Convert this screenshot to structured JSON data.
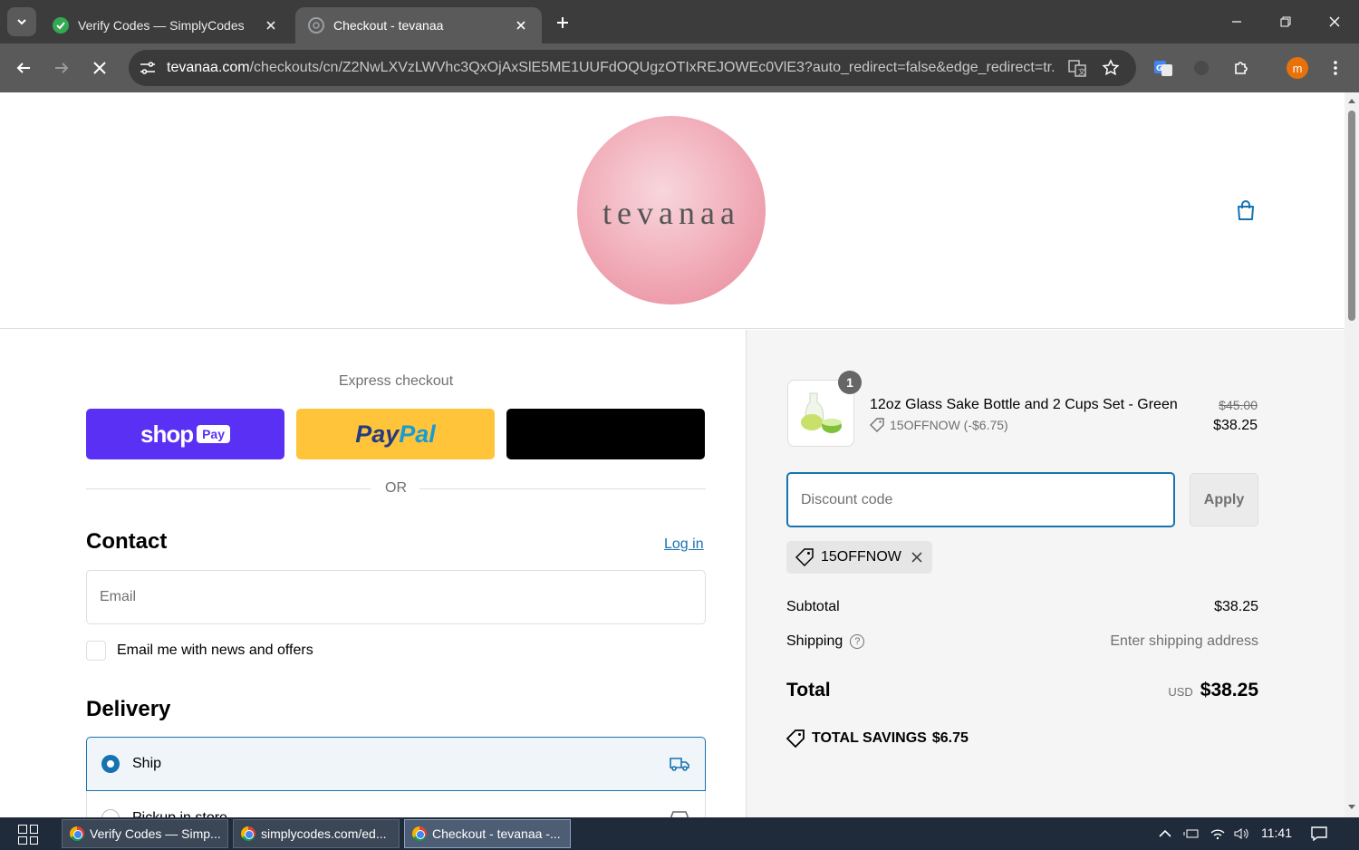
{
  "browser": {
    "tabs": [
      {
        "title": "Verify Codes — SimplyCodes",
        "active": false
      },
      {
        "title": "Checkout - tevanaa",
        "active": true
      }
    ],
    "url_host": "tevanaa.com",
    "url_path": "/checkouts/cn/Z2NwLXVzLWVhc3QxOjAxSlE5ME1UUFdOQUgzOTIxREJOWEc0VlE3?auto_redirect=false&edge_redirect=tr...",
    "profile_initial": "m"
  },
  "store": {
    "logo_text": "tevanaa"
  },
  "checkout": {
    "express_label": "Express checkout",
    "shop_pay": {
      "word": "shop",
      "badge": "Pay"
    },
    "paypal": {
      "part1": "Pay",
      "part2": "Pal"
    },
    "or_text": "OR",
    "contact_title": "Contact",
    "login_label": "Log in",
    "email_placeholder": "Email",
    "newsletter_label": "Email me with news and offers",
    "delivery_title": "Delivery",
    "delivery_options": [
      {
        "label": "Ship",
        "selected": true
      },
      {
        "label": "Pickup in store",
        "selected": false
      }
    ]
  },
  "summary": {
    "item": {
      "quantity": "1",
      "name": "12oz Glass Sake Bottle and 2 Cups Set - Green",
      "discount": "15OFFNOW (-$6.75)",
      "original_price": "$45.00",
      "price": "$38.25"
    },
    "discount_placeholder": "Discount code",
    "apply_label": "Apply",
    "applied_code": "15OFFNOW",
    "subtotal_label": "Subtotal",
    "subtotal_value": "$38.25",
    "shipping_label": "Shipping",
    "shipping_value": "Enter shipping address",
    "total_label": "Total",
    "currency": "USD",
    "total_value": "$38.25",
    "savings_label": "TOTAL SAVINGS",
    "savings_value": "$6.75"
  },
  "taskbar": {
    "items": [
      {
        "title": "Verify Codes — Simp...",
        "active": false
      },
      {
        "title": "simplycodes.com/ed...",
        "active": false
      },
      {
        "title": "Checkout - tevanaa -...",
        "active": true
      }
    ],
    "time": "11:41"
  },
  "colors": {
    "accent": "#1773b0",
    "shop_pay": "#5a31f4",
    "paypal": "#ffc439",
    "summary_bg": "#f5f5f5"
  }
}
